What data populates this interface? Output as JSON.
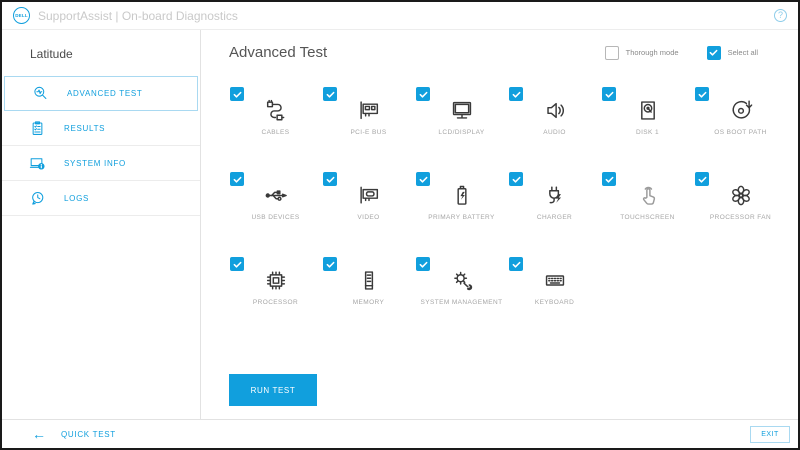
{
  "header": {
    "logo_text": "DELL",
    "title": "SupportAssist | On-board Diagnostics",
    "help_icon": "?"
  },
  "sidebar": {
    "device_name": "Latitude",
    "items": [
      {
        "label": "ADVANCED TEST",
        "icon": "advanced-test-search-icon",
        "selected": true
      },
      {
        "label": "RESULTS",
        "icon": "results-clipboard-icon",
        "selected": false
      },
      {
        "label": "SYSTEM INFO",
        "icon": "system-info-icon",
        "selected": false
      },
      {
        "label": "LOGS",
        "icon": "logs-history-icon",
        "selected": false
      }
    ]
  },
  "main": {
    "title": "Advanced Test",
    "thorough_mode": {
      "label": "Thorough mode",
      "checked": false
    },
    "select_all": {
      "label": "Select all",
      "checked": true
    },
    "tests": [
      {
        "label": "CABLES",
        "icon": "cables-icon",
        "checked": true,
        "muted": false
      },
      {
        "label": "PCI-E BUS",
        "icon": "pcie-bus-icon",
        "checked": true,
        "muted": false
      },
      {
        "label": "LCD/DISPLAY",
        "icon": "lcd-display-icon",
        "checked": true,
        "muted": false
      },
      {
        "label": "AUDIO",
        "icon": "audio-speaker-icon",
        "checked": true,
        "muted": false
      },
      {
        "label": "DISK 1",
        "icon": "disk-icon",
        "checked": true,
        "muted": false
      },
      {
        "label": "OS BOOT PATH",
        "icon": "os-boot-path-icon",
        "checked": true,
        "muted": false
      },
      {
        "label": "USB DEVICES",
        "icon": "usb-icon",
        "checked": true,
        "muted": false
      },
      {
        "label": "VIDEO",
        "icon": "video-card-icon",
        "checked": true,
        "muted": false
      },
      {
        "label": "PRIMARY BATTERY",
        "icon": "battery-icon",
        "checked": true,
        "muted": false
      },
      {
        "label": "CHARGER",
        "icon": "charger-plug-icon",
        "checked": true,
        "muted": false
      },
      {
        "label": "TOUCHSCREEN",
        "icon": "touchscreen-icon",
        "checked": true,
        "muted": true
      },
      {
        "label": "PROCESSOR FAN",
        "icon": "processor-fan-icon",
        "checked": true,
        "muted": false
      },
      {
        "label": "PROCESSOR",
        "icon": "processor-chip-icon",
        "checked": true,
        "muted": false
      },
      {
        "label": "MEMORY",
        "icon": "memory-icon",
        "checked": true,
        "muted": false
      },
      {
        "label": "SYSTEM MANAGEMENT",
        "icon": "system-management-icon",
        "checked": true,
        "muted": false
      },
      {
        "label": "KEYBOARD",
        "icon": "keyboard-icon",
        "checked": true,
        "muted": false
      }
    ],
    "run_button_label": "RUN TEST"
  },
  "footer": {
    "back_label": "QUICK TEST",
    "back_icon": "arrow-left-icon",
    "exit_label": "EXIT"
  },
  "colors": {
    "primary_blue": "#119fdd",
    "selected_border_blue": "#a9d9f1",
    "icon_dark": "#3a3a3a",
    "label_gray": "#a6a6a6",
    "title_gray": "#555555"
  }
}
